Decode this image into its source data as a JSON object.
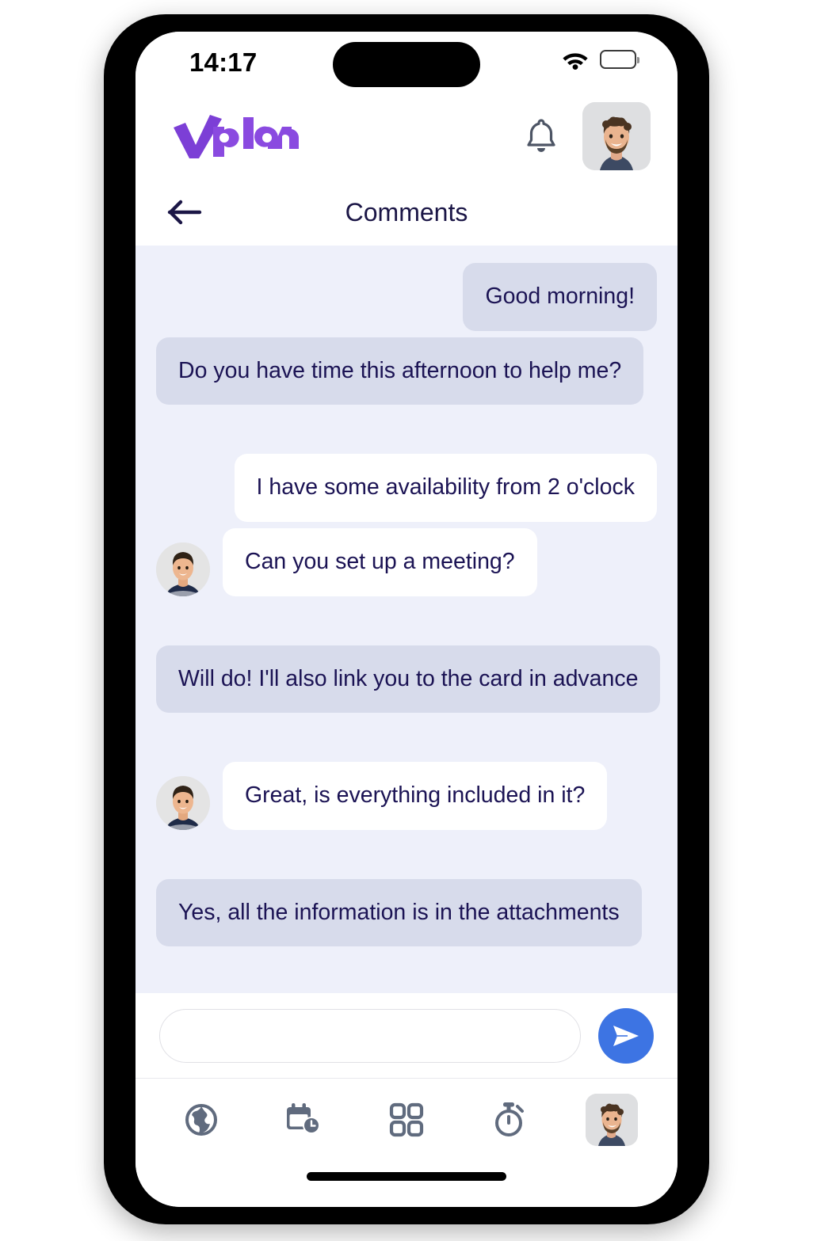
{
  "status_bar": {
    "time": "14:17",
    "wifi_icon": "wifi-icon",
    "battery_icon": "battery-full-icon"
  },
  "app_header": {
    "brand": "vplan",
    "brand_color": "#8447e0",
    "notification_icon": "bell-icon",
    "avatar_label": "user-avatar"
  },
  "sub_header": {
    "back_icon": "arrow-left-icon",
    "title": "Comments"
  },
  "chat": {
    "background_color": "#eef0fa",
    "incoming_bubble_color": "#d7dbeb",
    "outgoing_bubble_color": "#ffffff",
    "text_color": "#1b1354",
    "messages": [
      {
        "text": "Good morning!",
        "side": "right",
        "variant": "them",
        "avatar": false
      },
      {
        "text": "Do you have time this afternoon to help me?",
        "side": "left",
        "variant": "them",
        "avatar": false
      },
      {
        "text": "I have some availability from 2 o'clock",
        "side": "right",
        "variant": "me",
        "avatar": false
      },
      {
        "text": "Can you set up a meeting?",
        "side": "left",
        "variant": "me",
        "avatar": true
      },
      {
        "text": "Will do! I'll also link you to the card in advance",
        "side": "left",
        "variant": "them",
        "avatar": false
      },
      {
        "text": "Great, is everything included in it?",
        "side": "left",
        "variant": "me",
        "avatar": true
      },
      {
        "text": "Yes, all the information is in the attachments",
        "side": "left",
        "variant": "them",
        "avatar": false
      }
    ]
  },
  "composer": {
    "input_value": "",
    "placeholder": "",
    "send_icon": "send-icon",
    "send_button_color": "#3d74e3"
  },
  "bottom_nav": {
    "icon_color": "#606b7e",
    "items": [
      {
        "icon": "globe-icon",
        "label": ""
      },
      {
        "icon": "calendar-clock-icon",
        "label": ""
      },
      {
        "icon": "grid-icon",
        "label": ""
      },
      {
        "icon": "stopwatch-icon",
        "label": ""
      },
      {
        "icon": "profile-avatar-icon",
        "label": ""
      }
    ]
  }
}
